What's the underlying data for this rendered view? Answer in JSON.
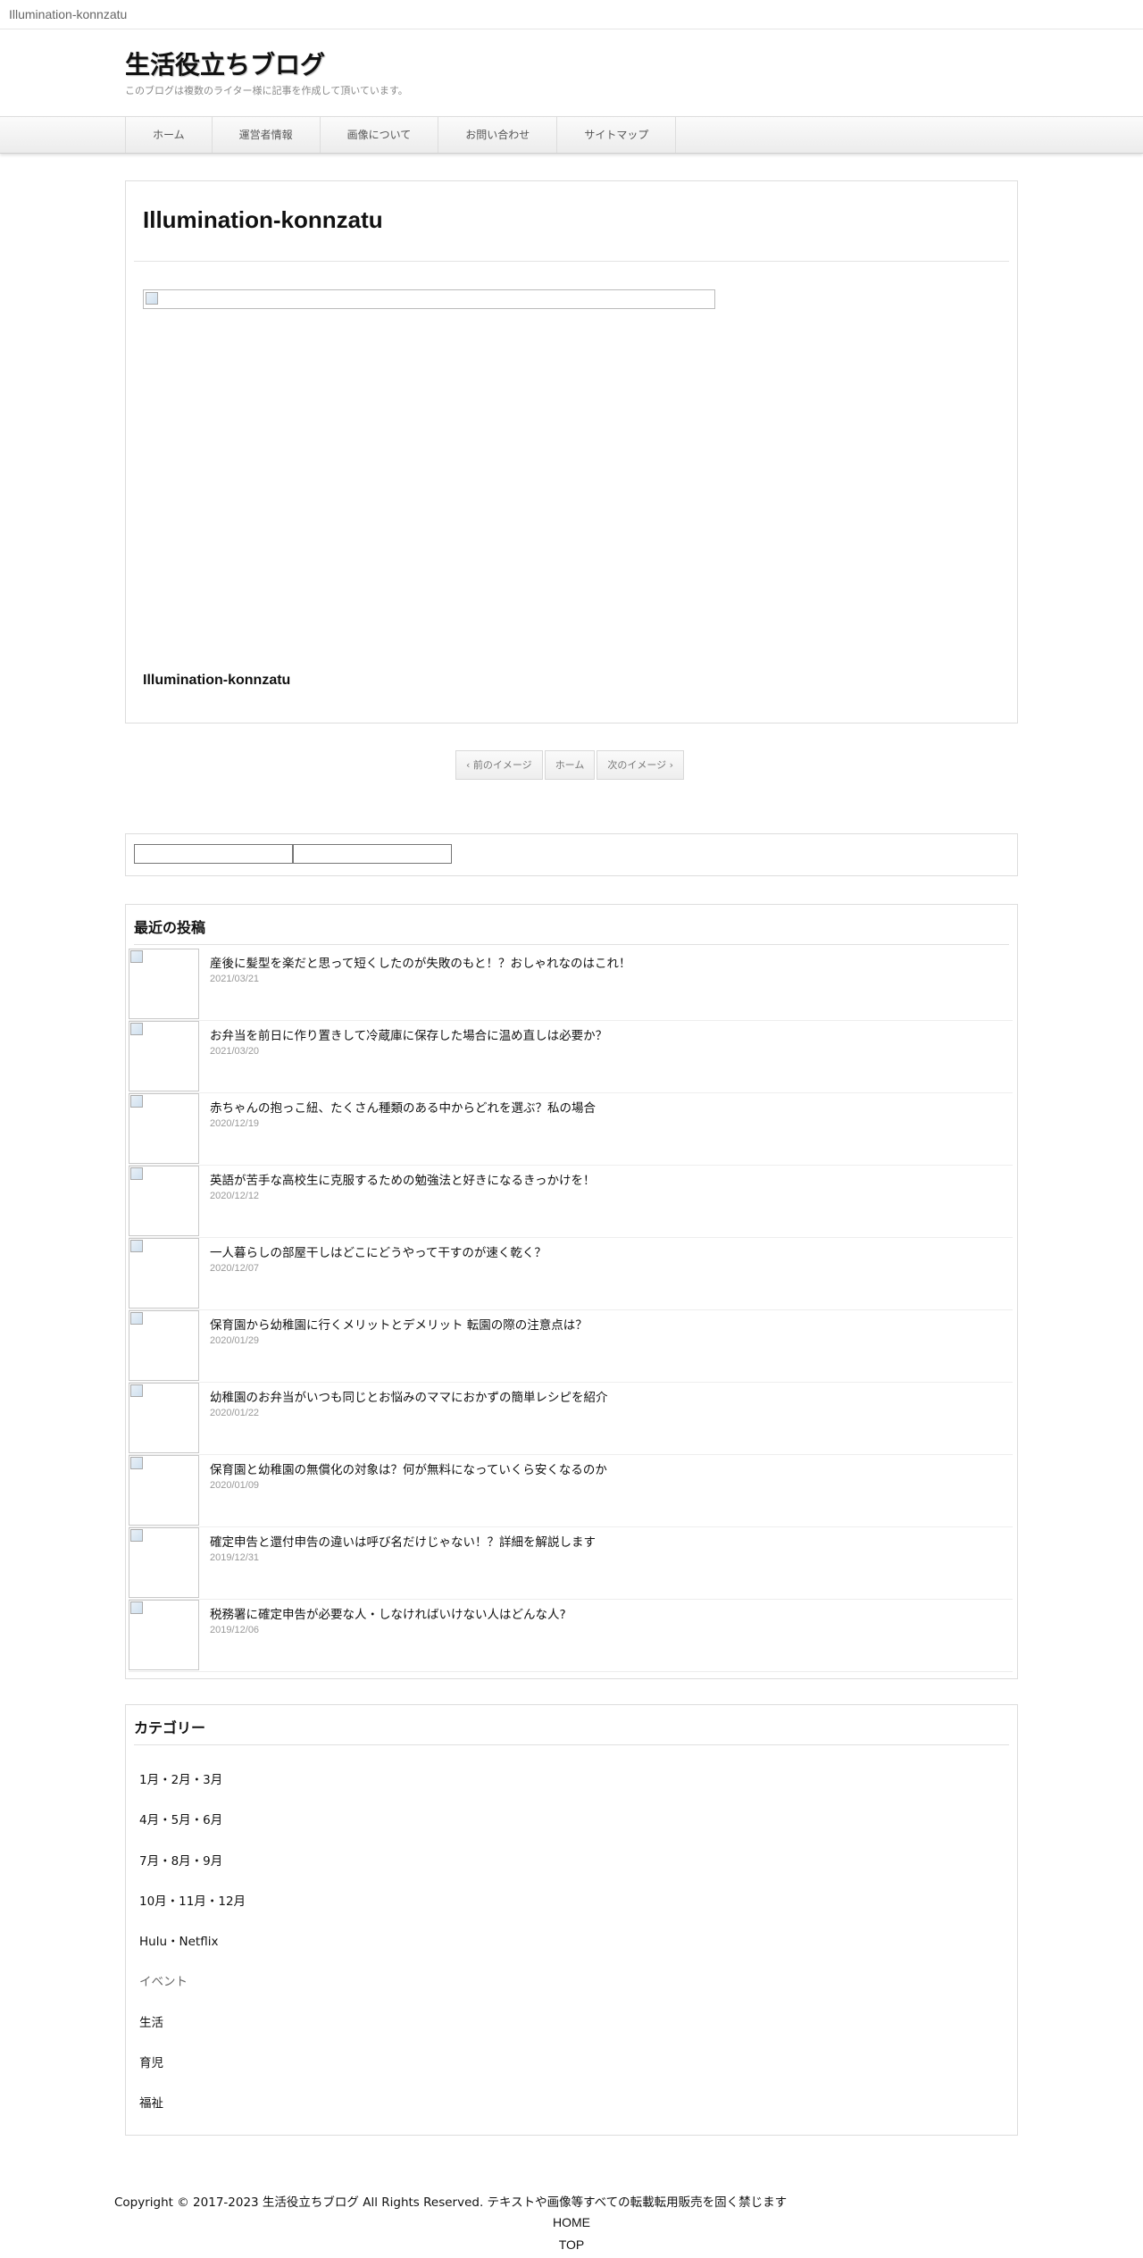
{
  "browser": {
    "tab_title": "Illumination-konnzatu"
  },
  "site": {
    "title": "生活役立ちブログ",
    "description": "このブログは複数のライター様に記事を作成して頂いています。"
  },
  "nav": {
    "items": [
      "ホーム",
      "運営者情報",
      "画像について",
      "お問い合わせ",
      "サイトマップ"
    ]
  },
  "post": {
    "title": "Illumination-konnzatu",
    "caption": "Illumination-konnzatu"
  },
  "pager": {
    "prev": "‹ 前のイメージ",
    "home": "ホーム",
    "next": "次のイメージ ›"
  },
  "recent": {
    "heading": "最近の投稿",
    "posts": [
      {
        "title": "産後に髪型を楽だと思って短くしたのが失敗のもと！？おしゃれなのはこれ！",
        "date": "2021/03/21"
      },
      {
        "title": "お弁当を前日に作り置きして冷蔵庫に保存した場合に温め直しは必要か？",
        "date": "2021/03/20"
      },
      {
        "title": "赤ちゃんの抱っこ紐、たくさん種類のある中からどれを選ぶ？私の場合",
        "date": "2020/12/19"
      },
      {
        "title": "英語が苦手な高校生に克服するための勉強法と好きになるきっかけを！",
        "date": "2020/12/12"
      },
      {
        "title": "一人暮らしの部屋干しはどこにどうやって干すのが速く乾く？",
        "date": "2020/12/07"
      },
      {
        "title": "保育園から幼稚園に行くメリットとデメリット 転園の際の注意点は？",
        "date": "2020/01/29"
      },
      {
        "title": "幼稚園のお弁当がいつも同じとお悩みのママにおかずの簡単レシピを紹介",
        "date": "2020/01/22"
      },
      {
        "title": "保育園と幼稚園の無償化の対象は？何が無料になっていくら安くなるのか",
        "date": "2020/01/09"
      },
      {
        "title": "確定申告と還付申告の違いは呼び名だけじゃない！？詳細を解説します",
        "date": "2019/12/31"
      },
      {
        "title": "税務署に確定申告が必要な人・しなければいけない人はどんな人?",
        "date": "2019/12/06"
      }
    ]
  },
  "categories": {
    "heading": "カテゴリー",
    "items": [
      "1月・2月・3月",
      "4月・5月・6月",
      "7月・8月・9月",
      "10月・11月・12月",
      "Hulu・Netflix",
      "イベント",
      "生活",
      "育児",
      "福祉"
    ]
  },
  "footer": {
    "copyright": "Copyright © 2017-2023 生活役立ちブログ All Rights Reserved. テキストや画像等すべての転載転用販売を固く禁じます",
    "home_link": "HOME",
    "top_link": "TOP"
  }
}
